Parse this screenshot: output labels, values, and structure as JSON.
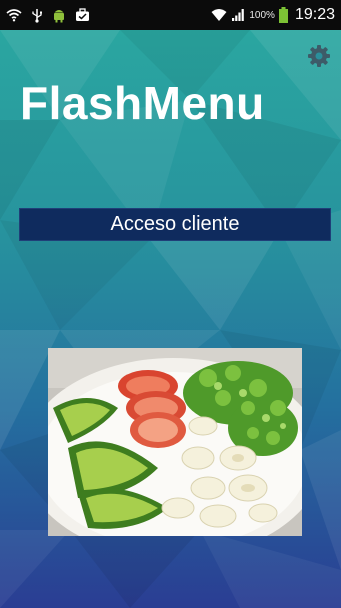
{
  "status_bar": {
    "battery_percent": "100%",
    "time": "19:23",
    "left_icons": [
      "wifi-alert-icon",
      "usb-icon",
      "android-icon",
      "briefcase-icon"
    ],
    "right_icons": [
      "wifi-icon",
      "signal-icon",
      "battery-icon"
    ]
  },
  "app": {
    "title": "FlashMenu",
    "access_button_label": "Acceso cliente",
    "settings_icon": "gear-icon",
    "hero_image": "salad-plate-photo"
  },
  "colors": {
    "background_top": "#2aa6a0",
    "background_bottom": "#2a3d93",
    "button_bg": "#0f2b5e",
    "title_text": "#ffffff"
  }
}
